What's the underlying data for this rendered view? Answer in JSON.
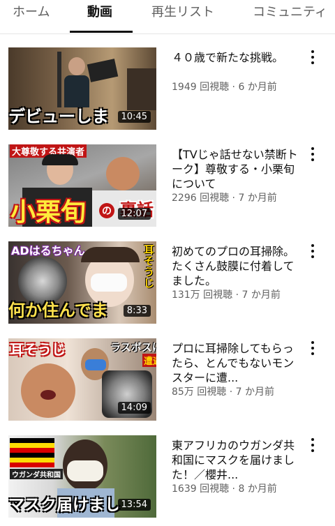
{
  "tabs": [
    {
      "label": "ホーム",
      "active": false
    },
    {
      "label": "動画",
      "active": true
    },
    {
      "label": "再生リスト",
      "active": false
    },
    {
      "label": "コミュニティ",
      "active": false
    }
  ],
  "videos": [
    {
      "title": "４０歳で新たな挑戦。",
      "views": "1949 回視聴",
      "age": "6 か月前",
      "duration": "10:45",
      "thumb_caption": "デビューしま",
      "thumb_labels": []
    },
    {
      "title": "【TVじゃ話せない禁断トーク】尊敬する・小栗旬について",
      "views": "2296 回視聴",
      "age": "7 か月前",
      "duration": "12:07",
      "thumb_caption": "小栗旬",
      "thumb_labels": [
        "大尊敬する共演者",
        "の",
        "裏話"
      ]
    },
    {
      "title": "初めてのプロの耳掃除。たくさん鼓膜に付着してました。",
      "views": "131万 回視聴",
      "age": "7 か月前",
      "duration": "8:33",
      "thumb_caption": "何か住んでま",
      "thumb_labels": [
        "ADはるちゃん",
        "耳そうじ"
      ]
    },
    {
      "title": "プロに耳掃除してもらったら、とんでもないモンスターに遭...",
      "views": "85万 回視聴",
      "age": "7 か月前",
      "duration": "14:09",
      "thumb_caption": "",
      "thumb_labels": [
        "耳そうじ",
        "ラスボスに",
        "遭遇"
      ]
    },
    {
      "title": "東アフリカのウガンダ共和国にマスクを届けました！／櫻井...",
      "views": "1639 回視聴",
      "age": "8 か月前",
      "duration": "13:54",
      "thumb_caption": "マスク届けまし",
      "thumb_labels": [
        "ウガンダ共和国"
      ]
    }
  ],
  "meta_separator": "·",
  "icons": {
    "more": "more-vert-icon"
  },
  "colors": {
    "active_tab": "#0f0f0f",
    "inactive_tab": "#606060",
    "meta": "#606060",
    "duration_bg": "#000000"
  }
}
